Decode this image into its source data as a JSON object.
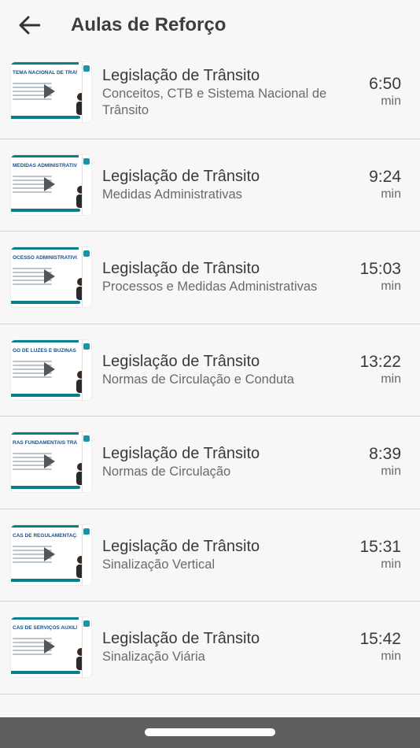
{
  "header": {
    "title": "Aulas de Reforço",
    "back_icon": "arrow-left-icon"
  },
  "colors": {
    "accent": "#0a7f8c",
    "text": "#3a3a3a",
    "subtext": "#6a6a6a",
    "divider": "#d3d3d3",
    "navbar": "#5f5f5f"
  },
  "lessons": [
    {
      "title": "Legislação de Trânsito",
      "subtitle": "Conceitos, CTB e Sistema Nacional de Trânsito",
      "duration": "6:50",
      "unit": "min",
      "thumb_heading": "TEMA NACIONAL DE TRÂNSITO EUS OBJETIVOS:"
    },
    {
      "title": "Legislação de Trânsito",
      "subtitle": "Medidas Administrativas",
      "duration": "9:24",
      "unit": "min",
      "thumb_heading": "MEDIDAS ADMINISTRATIVAS"
    },
    {
      "title": "Legislação de Trânsito",
      "subtitle": "Processos e Medidas Administrativas",
      "duration": "15:03",
      "unit": "min",
      "thumb_heading": "OCESSO ADMINISTRATIVO"
    },
    {
      "title": "Legislação de Trânsito",
      "subtitle": "Normas de Circulação e Conduta",
      "duration": "13:22",
      "unit": "min",
      "thumb_heading": "GO DE LUZES E BUZINAS"
    },
    {
      "title": "Legislação de Trânsito",
      "subtitle": "Normas de Circulação",
      "duration": "8:39",
      "unit": "min",
      "thumb_heading": "RAS FUNDAMENTAIS TRÂNSITO"
    },
    {
      "title": "Legislação de Trânsito",
      "subtitle": "Sinalização Vertical",
      "duration": "15:31",
      "unit": "min",
      "thumb_heading": "CAS DE REGULAMENTAÇÃO"
    },
    {
      "title": "Legislação de Trânsito",
      "subtitle": "Sinalização Viária",
      "duration": "15:42",
      "unit": "min",
      "thumb_heading": "CAS DE SERVIÇOS AUXILIARES USUÁRIOS - SAU"
    }
  ]
}
